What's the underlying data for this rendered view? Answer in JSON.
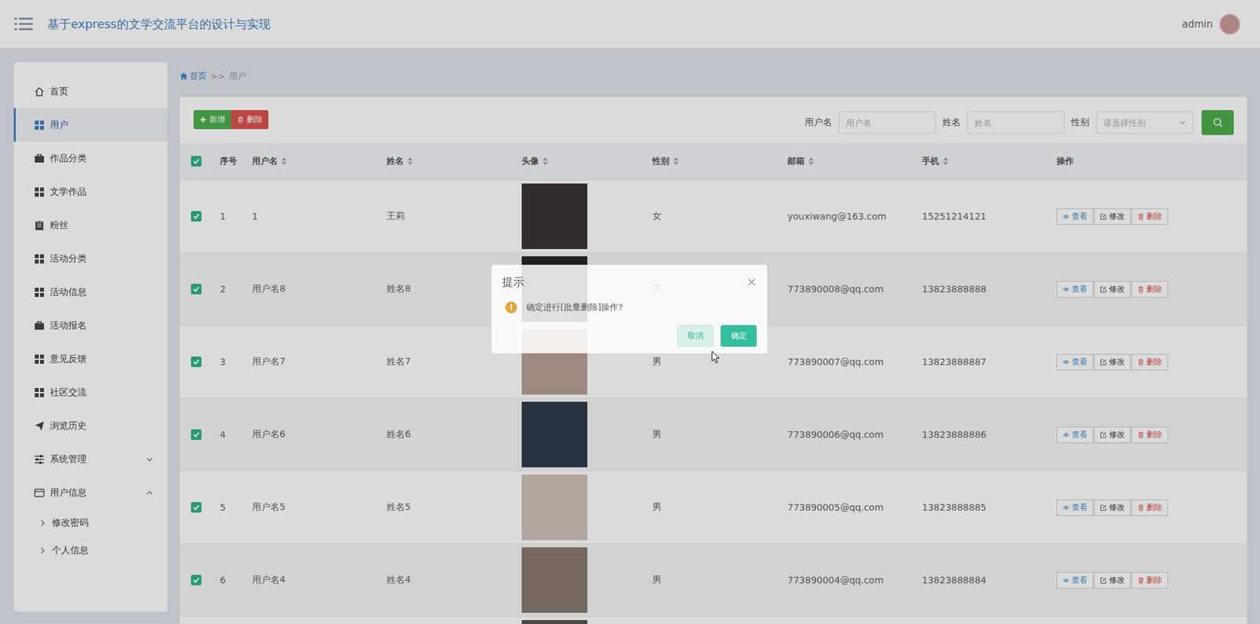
{
  "header": {
    "title": "基于express的文学交流平台的设计与实现",
    "user": "admin"
  },
  "sidebar": {
    "items": [
      {
        "label": "首页",
        "selected": false
      },
      {
        "label": "用户",
        "selected": true
      },
      {
        "label": "作品分类",
        "selected": false
      },
      {
        "label": "文学作品",
        "selected": false
      },
      {
        "label": "粉丝",
        "selected": false
      },
      {
        "label": "活动分类",
        "selected": false
      },
      {
        "label": "活动信息",
        "selected": false
      },
      {
        "label": "活动报名",
        "selected": false
      },
      {
        "label": "意见反馈",
        "selected": false
      },
      {
        "label": "社区交流",
        "selected": false
      },
      {
        "label": "浏览历史",
        "selected": false
      },
      {
        "label": "系统管理",
        "selected": false,
        "expanded": false,
        "children": []
      },
      {
        "label": "用户信息",
        "selected": false,
        "expanded": true,
        "children": [
          {
            "label": "修改密码"
          },
          {
            "label": "个人信息"
          }
        ]
      }
    ]
  },
  "breadcrumb": {
    "home": "首页",
    "separator": ">>",
    "current": "用户"
  },
  "toolbar": {
    "buttons": [
      "新增",
      "删除"
    ],
    "filters": [
      {
        "label": "用户名",
        "placeholder": "用户名",
        "kind": "input"
      },
      {
        "label": "姓名",
        "placeholder": "姓名",
        "kind": "input"
      },
      {
        "label": "性别",
        "placeholder": "请选择性别",
        "kind": "select"
      }
    ]
  },
  "table": {
    "all_checked": true,
    "columns": [
      {
        "label": "序号",
        "sortable": false
      },
      {
        "label": "用户名",
        "sortable": true
      },
      {
        "label": "姓名",
        "sortable": true
      },
      {
        "label": "头像",
        "sortable": true
      },
      {
        "label": "性别",
        "sortable": true
      },
      {
        "label": "邮箱",
        "sortable": true
      },
      {
        "label": "手机",
        "sortable": true
      },
      {
        "label": "操作",
        "sortable": false
      }
    ],
    "actions": [
      "查看",
      "修改",
      "删除"
    ],
    "rows": [
      {
        "checked": true,
        "index": "1",
        "username": "1",
        "name": "王莉",
        "gender": "女",
        "email": "youxiwang@163.com",
        "phone": "15251214121"
      },
      {
        "checked": true,
        "index": "2",
        "username": "用户名8",
        "name": "姓名8",
        "gender": "男",
        "email": "773890008@qq.com",
        "phone": "13823888888"
      },
      {
        "checked": true,
        "index": "3",
        "username": "用户名7",
        "name": "姓名7",
        "gender": "男",
        "email": "773890007@qq.com",
        "phone": "13823888887"
      },
      {
        "checked": true,
        "index": "4",
        "username": "用户名6",
        "name": "姓名6",
        "gender": "男",
        "email": "773890006@qq.com",
        "phone": "13823888886"
      },
      {
        "checked": true,
        "index": "5",
        "username": "用户名5",
        "name": "姓名5",
        "gender": "男",
        "email": "773890005@qq.com",
        "phone": "13823888885"
      },
      {
        "checked": true,
        "index": "6",
        "username": "用户名4",
        "name": "姓名4",
        "gender": "男",
        "email": "773890004@qq.com",
        "phone": "13823888884"
      }
    ]
  },
  "dialog": {
    "title": "提示",
    "close": "×",
    "icon": "!",
    "message": "确定进行[批量删除]操作?",
    "buttons": [
      {
        "label": "取消",
        "primary": false
      },
      {
        "label": "确定",
        "primary": true
      }
    ]
  }
}
